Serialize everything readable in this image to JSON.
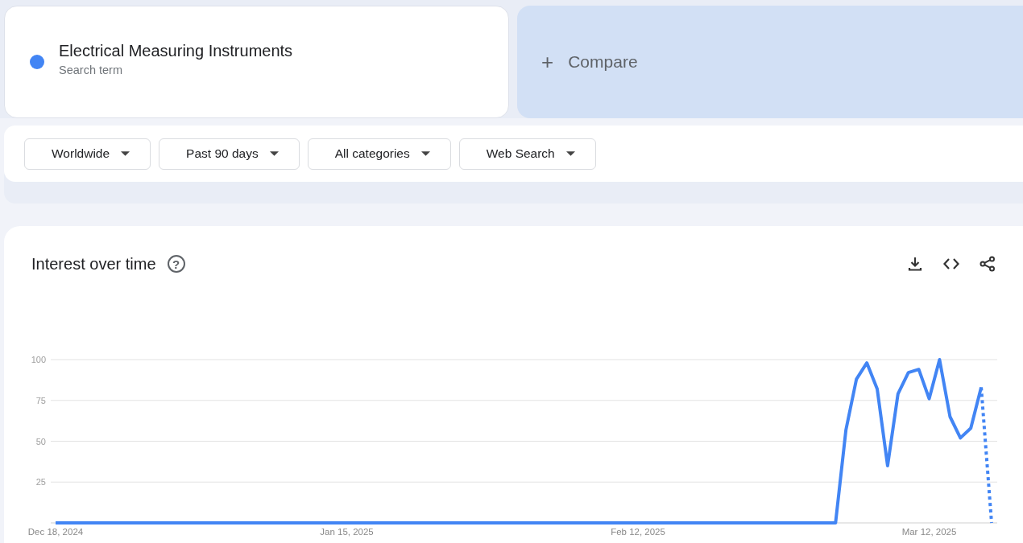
{
  "search_term": {
    "name": "Electrical Measuring Instruments",
    "caption": "Search term",
    "color": "#4285f4"
  },
  "compare": {
    "label": "Compare",
    "icon": "+"
  },
  "filters": [
    {
      "label": "Worldwide"
    },
    {
      "label": "Past 90 days"
    },
    {
      "label": "All categories"
    },
    {
      "label": "Web Search"
    }
  ],
  "interest_over_time": {
    "title": "Interest over time",
    "help": "?",
    "chart_data": {
      "type": "line",
      "categories": [
        "Dec 18, 2024",
        null,
        null,
        null,
        null,
        null,
        null,
        null,
        null,
        null,
        null,
        null,
        null,
        null,
        null,
        null,
        null,
        null,
        null,
        null,
        null,
        null,
        null,
        null,
        null,
        null,
        null,
        null,
        "Jan 15, 2025",
        null,
        null,
        null,
        null,
        null,
        null,
        null,
        null,
        null,
        null,
        null,
        null,
        null,
        null,
        null,
        null,
        null,
        null,
        null,
        null,
        null,
        null,
        null,
        null,
        null,
        null,
        null,
        "Feb 12, 2025",
        null,
        null,
        null,
        null,
        null,
        null,
        null,
        null,
        null,
        null,
        null,
        null,
        null,
        null,
        null,
        null,
        null,
        null,
        null,
        null,
        null,
        null,
        null,
        null,
        null,
        null,
        null,
        "Mar 12, 2025",
        null,
        null,
        null,
        null,
        null,
        null
      ],
      "series": [
        {
          "color": "#4285f4",
          "values": [
            0,
            0,
            0,
            0,
            0,
            0,
            0,
            0,
            0,
            0,
            0,
            0,
            0,
            0,
            0,
            0,
            0,
            0,
            0,
            0,
            0,
            0,
            0,
            0,
            0,
            0,
            0,
            0,
            0,
            0,
            0,
            0,
            0,
            0,
            0,
            0,
            0,
            0,
            0,
            0,
            0,
            0,
            0,
            0,
            0,
            0,
            0,
            0,
            0,
            0,
            0,
            0,
            0,
            0,
            0,
            0,
            0,
            0,
            0,
            0,
            0,
            0,
            0,
            0,
            0,
            0,
            0,
            0,
            0,
            0,
            0,
            0,
            0,
            0,
            0,
            0,
            57,
            88,
            98,
            82,
            35,
            79,
            92,
            94,
            76,
            100,
            65,
            52,
            58,
            83,
            0
          ]
        }
      ],
      "ylim": [
        0,
        100
      ],
      "grid": true,
      "yticks": [
        25,
        50,
        75,
        100
      ]
    }
  }
}
